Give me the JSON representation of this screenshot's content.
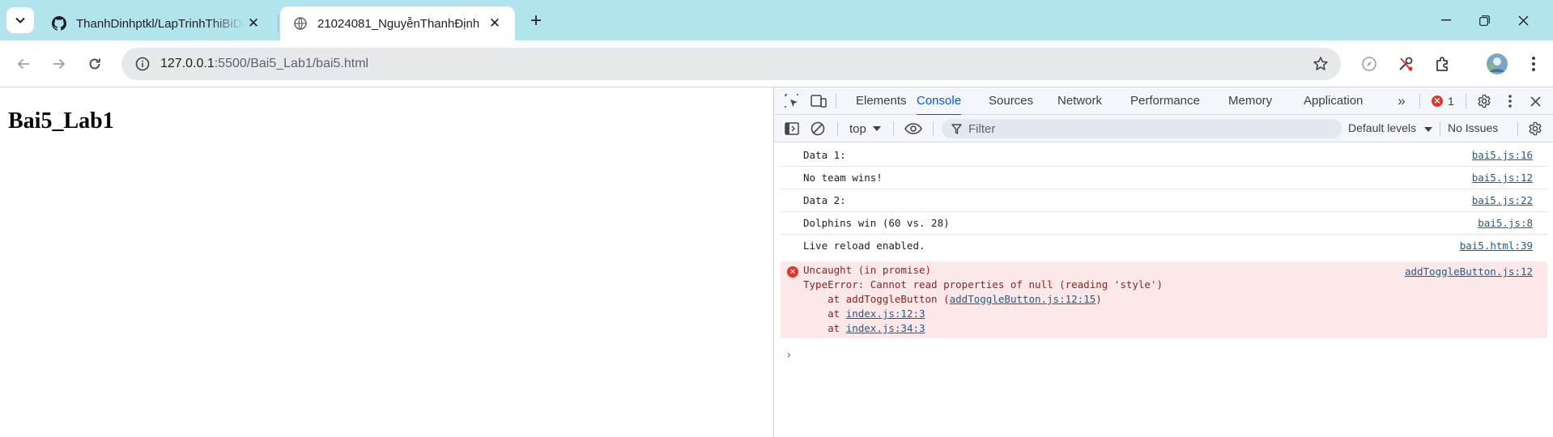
{
  "tabs": [
    {
      "title": "ThanhDinhptkl/LapTrinhThiBiDiDong",
      "favicon": "github-icon"
    },
    {
      "title": "21024081_NguyễnThanhĐịnh",
      "favicon": "globe-icon"
    }
  ],
  "omnibox": {
    "host": "127.0.0.1",
    "path": ":5500/Bai5_Lab1/bai5.html"
  },
  "page": {
    "heading": "Bai5_Lab1"
  },
  "devtools": {
    "tabs": [
      "Elements",
      "Console",
      "Sources",
      "Network",
      "Performance",
      "Memory",
      "Application"
    ],
    "selected_tab": "Console",
    "error_count": "1",
    "context": "top",
    "filter_placeholder": "Filter",
    "levels": "Default levels",
    "issues": "No Issues",
    "messages": [
      {
        "text": "Data 1:",
        "source": "bai5.js:16"
      },
      {
        "text": "No team wins!",
        "source": "bai5.js:12"
      },
      {
        "text": "Data 2:",
        "source": "bai5.js:22"
      },
      {
        "text": "Dolphins win (60 vs. 28)",
        "source": "bai5.js:8"
      },
      {
        "text": "Live reload enabled.",
        "source": "bai5.html:39"
      }
    ],
    "error": {
      "title": "Uncaught (in promise)",
      "source": "addToggleButton.js:12",
      "message": "TypeError: Cannot read properties of null (reading 'style')",
      "stack": [
        {
          "prefix": "    at addToggleButton (",
          "link": "addToggleButton.js:12:15",
          "suffix": ")"
        },
        {
          "prefix": "    at ",
          "link": "index.js:12:3",
          "suffix": ""
        },
        {
          "prefix": "    at ",
          "link": "index.js:34:3",
          "suffix": ""
        }
      ]
    },
    "prompt": "›"
  }
}
